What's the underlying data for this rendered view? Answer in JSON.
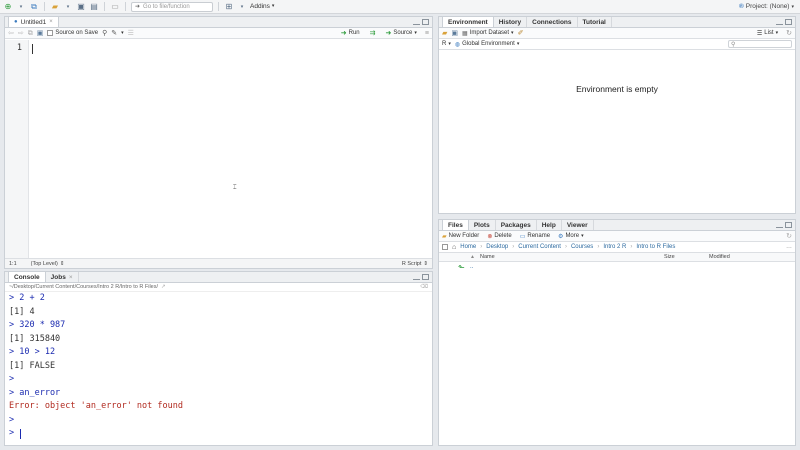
{
  "topbar": {
    "goto_placeholder": "Go to file/function",
    "addins_label": "Addins",
    "project_label": "Project: (None)"
  },
  "editor": {
    "tab_label": "Untitled1",
    "source_on_save_label": "Source on Save",
    "run_label": "Run",
    "source_label": "Source",
    "line_number": "1",
    "status_position": "1:1",
    "status_scope": "(Top Level)",
    "status_type": "R Script"
  },
  "console": {
    "tabs": [
      "Console",
      "Jobs"
    ],
    "path": "~/Desktop/Current Content/Courses/Intro 2 R/Intro to R Files/",
    "lines": [
      {
        "text": "> 2 + 2",
        "kind": "cmd"
      },
      {
        "text": "[1] 4",
        "kind": "out"
      },
      {
        "text": "> 320 * 987",
        "kind": "cmd"
      },
      {
        "text": "[1] 315840",
        "kind": "out"
      },
      {
        "text": "> 10 > 12",
        "kind": "cmd"
      },
      {
        "text": "[1] FALSE",
        "kind": "out"
      },
      {
        "text": ">",
        "kind": "cmd"
      },
      {
        "text": "> an_error",
        "kind": "cmd"
      },
      {
        "text": "Error: object 'an_error' not found",
        "kind": "err"
      },
      {
        "text": ">",
        "kind": "cmd"
      },
      {
        "text": "> ",
        "kind": "cmd"
      }
    ]
  },
  "environment": {
    "tabs": [
      "Environment",
      "History",
      "Connections",
      "Tutorial"
    ],
    "import_label": "Import Dataset",
    "list_label": "List",
    "r_label": "R",
    "scope_label": "Global Environment",
    "empty_message": "Environment is empty"
  },
  "files": {
    "tabs": [
      "Files",
      "Plots",
      "Packages",
      "Help",
      "Viewer"
    ],
    "new_folder_label": "New Folder",
    "delete_label": "Delete",
    "rename_label": "Rename",
    "more_label": "More",
    "breadcrumbs": [
      "Home",
      "Desktop",
      "Current Content",
      "Courses",
      "Intro 2 R",
      "Intro to R Files"
    ],
    "columns": {
      "name": "Name",
      "size": "Size",
      "modified": "Modified"
    },
    "rows": [
      {
        "name": ".."
      }
    ]
  }
}
